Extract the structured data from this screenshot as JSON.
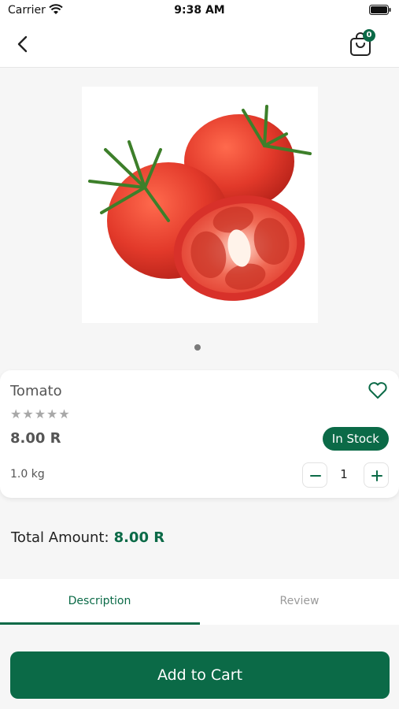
{
  "status_bar": {
    "carrier": "Carrier",
    "time": "9:38 AM"
  },
  "header": {
    "cart_count": "0"
  },
  "product": {
    "name": "Tomato",
    "rating": "★★★★★",
    "price": "8.00 R",
    "stock_status": "In Stock",
    "weight": "1.0 kg",
    "quantity": "1"
  },
  "total": {
    "label": "Total Amount:",
    "amount": "8.00 R"
  },
  "tabs": [
    {
      "label": "Description"
    },
    {
      "label": "Review"
    }
  ],
  "add_to_cart_label": "Add to Cart",
  "colors": {
    "accent": "#0b6a47",
    "tomato": "#e2392a"
  }
}
